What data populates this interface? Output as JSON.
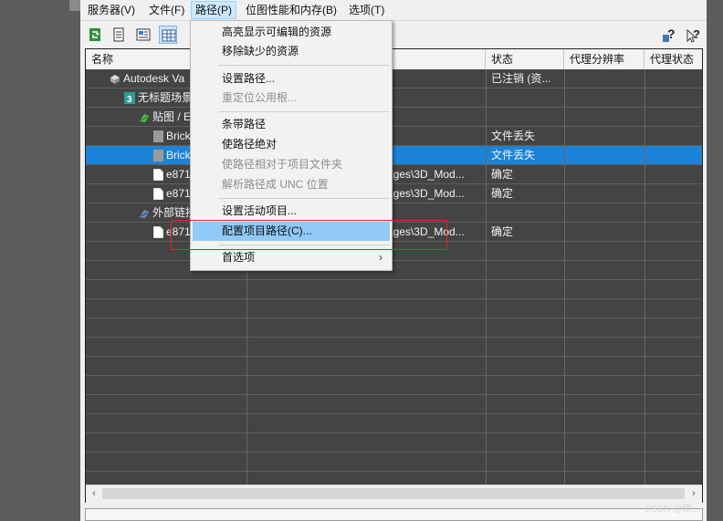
{
  "menubar": {
    "items": [
      "服务器(V)",
      "文件(F)",
      "路径(P)",
      "位图性能和内存(B)",
      "选项(T)"
    ]
  },
  "table": {
    "headers": [
      "名称",
      "状态",
      "代理分辨率",
      "代理状态"
    ],
    "rows": [
      {
        "name": "Autodesk Va",
        "path": "",
        "status": "已注销 (资..."
      },
      {
        "name": "无标题场景",
        "path": "",
        "status": ""
      },
      {
        "name": "贴图 / E",
        "path": "",
        "status": ""
      },
      {
        "name": "Brick",
        "path": "",
        "status": "文件丢失"
      },
      {
        "name": "Brick",
        "path": "",
        "status": "文件丢失"
      },
      {
        "name": "e871",
        "path": "ages\\3D_Mod...",
        "status": "确定"
      },
      {
        "name": "e871",
        "path": "ages\\3D_Mod...",
        "status": "确定"
      },
      {
        "name": "外部链接",
        "path": "",
        "status": ""
      },
      {
        "name": "e871",
        "path": "ages\\3D_Mod...",
        "status": "确定"
      }
    ]
  },
  "dropdown": {
    "items": [
      {
        "label": "高亮显示可编辑的资源",
        "enabled": true
      },
      {
        "label": "移除缺少的资源",
        "enabled": true
      },
      {
        "label": "设置路径...",
        "enabled": true
      },
      {
        "label": "重定位公用根...",
        "enabled": false
      },
      {
        "label": "条带路径",
        "enabled": true
      },
      {
        "label": "使路径绝对",
        "enabled": true
      },
      {
        "label": "使路径相对于项目文件夹",
        "enabled": false
      },
      {
        "label": "解析路径成 UNC 位置",
        "enabled": false
      },
      {
        "label": "设置活动项目...",
        "enabled": true
      },
      {
        "label": "配置项目路径(C)...",
        "enabled": true
      },
      {
        "label": "首选项",
        "enabled": true
      }
    ]
  },
  "watermark": "CSDN @卿...",
  "colors": {
    "selection": "#1b84d8",
    "menu_hover": "#91c9f7",
    "highlight_box": "#e5212b"
  }
}
